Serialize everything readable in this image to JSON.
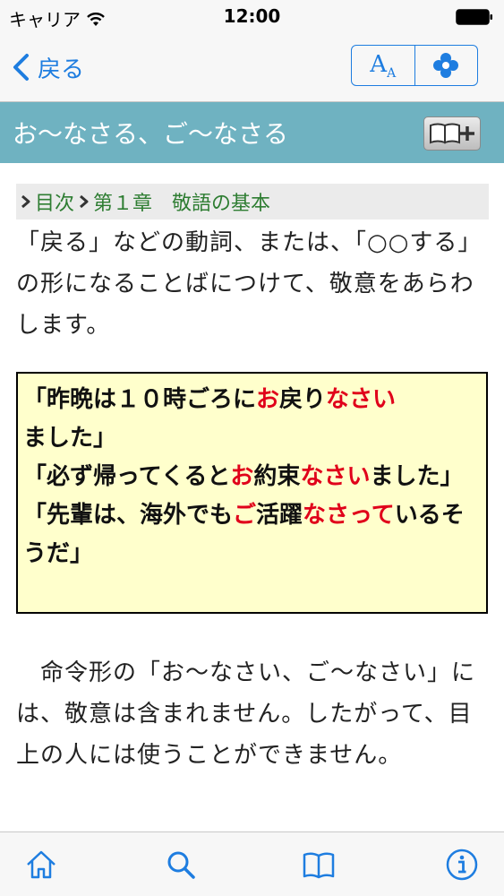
{
  "status_bar": {
    "carrier": "キャリア",
    "time": "12:00"
  },
  "nav": {
    "back_label": "戻る",
    "font_size_icon_big": "A",
    "font_size_icon_small": "A"
  },
  "title": "お〜なさる、ご〜なさる",
  "breadcrumb": {
    "toc": "目次",
    "chapter_num": "第１章",
    "chapter_title": "敬語の基本"
  },
  "intro_text": "「戻る」などの動詞、または、「○○する」の形になることばにつけて、敬意をあらわします。",
  "examples": [
    {
      "parts": [
        {
          "text": "「昨晩は１０時ごろに",
          "hl": false
        },
        {
          "text": "お",
          "hl": true
        },
        {
          "text": "戻り",
          "hl": false
        },
        {
          "text": "なさい",
          "hl": true
        },
        {
          "text": "ました」",
          "hl": false
        }
      ]
    },
    {
      "parts": [
        {
          "text": "「必ず帰ってくると",
          "hl": false
        },
        {
          "text": "お",
          "hl": true
        },
        {
          "text": "約束",
          "hl": false
        },
        {
          "text": "なさい",
          "hl": true
        },
        {
          "text": "ました」",
          "hl": false
        }
      ]
    },
    {
      "parts": [
        {
          "text": "「先輩は、海外でも",
          "hl": false
        },
        {
          "text": "ご",
          "hl": true
        },
        {
          "text": "活躍",
          "hl": false
        },
        {
          "text": "なさって",
          "hl": true
        },
        {
          "text": "いるそうだ」",
          "hl": false
        }
      ]
    }
  ],
  "note_text": "　命令形の「お〜なさい、ご〜なさい」には、敬意は含まれません。したがって、目上の人には使うことができません。",
  "colors": {
    "accent": "#1e7de0",
    "title_bar": "#6fb2c1",
    "breadcrumb_text": "#2e7d32",
    "highlight": "#e0001a",
    "example_bg": "#ffffcc"
  },
  "icons": {
    "back": "chevron-left-icon",
    "font_size": "font-size-icon",
    "settings": "clover-icon",
    "bookmark_add": "book-plus-icon",
    "tabs": [
      "home-icon",
      "search-icon",
      "book-icon",
      "info-icon"
    ]
  }
}
